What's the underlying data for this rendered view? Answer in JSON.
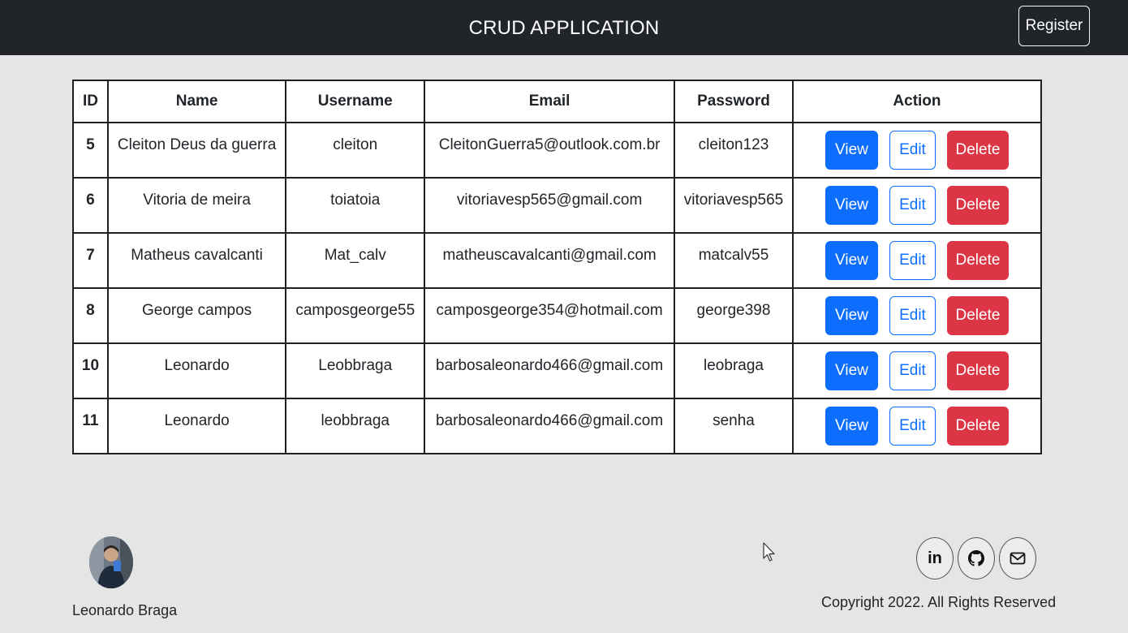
{
  "header": {
    "title": "CRUD APPLICATION",
    "register_label": "Register"
  },
  "table": {
    "columns": [
      "ID",
      "Name",
      "Username",
      "Email",
      "Password",
      "Action"
    ],
    "rows": [
      {
        "id": "5",
        "name": "Cleiton Deus da guerra",
        "username": "cleiton",
        "email": "CleitonGuerra5@outlook.com.br",
        "password": "cleiton123"
      },
      {
        "id": "6",
        "name": "Vitoria de meira",
        "username": "toiatoia",
        "email": "vitoriavesp565@gmail.com",
        "password": "vitoriavesp565"
      },
      {
        "id": "7",
        "name": "Matheus cavalcanti",
        "username": "Mat_calv",
        "email": "matheuscavalcanti@gmail.com",
        "password": "matcalv55"
      },
      {
        "id": "8",
        "name": "George campos",
        "username": "camposgeorge55",
        "email": "camposgeorge354@hotmail.com",
        "password": "george398"
      },
      {
        "id": "10",
        "name": "Leonardo",
        "username": "Leobbraga",
        "email": "barbosaleonardo466@gmail.com",
        "password": "leobraga"
      },
      {
        "id": "11",
        "name": "Leonardo",
        "username": "leobbraga",
        "email": "barbosaleonardo466@gmail.com",
        "password": "senha"
      }
    ],
    "actions": {
      "view": "View",
      "edit": "Edit",
      "delete": "Delete"
    }
  },
  "footer": {
    "author_name": "Leonardo Braga",
    "copyright": "Copyright 2022. All Rights Reserved",
    "social_icons": [
      "linkedin-icon",
      "github-icon",
      "mail-icon"
    ],
    "linkedin_glyph": "in"
  },
  "colors": {
    "navbar": "#212529",
    "primary": "#0d6efd",
    "danger": "#dc3545",
    "background": "#e5e5e5"
  }
}
